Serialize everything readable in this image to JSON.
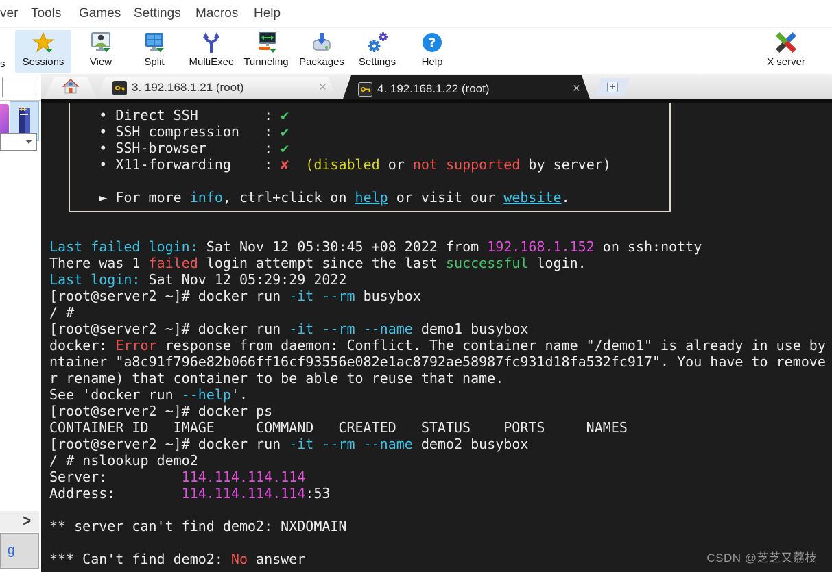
{
  "menu": {
    "items": [
      "ver",
      "Tools",
      "Games",
      "Settings",
      "Macros",
      "Help"
    ]
  },
  "toolbar": {
    "partial_label": "s",
    "buttons": [
      {
        "label": "Sessions",
        "icon": "sessions-star-icon",
        "highlighted": true
      },
      {
        "label": "View",
        "icon": "view-monitor-user-icon"
      },
      {
        "label": "Split",
        "icon": "split-monitor-icon"
      },
      {
        "label": "MultiExec",
        "icon": "multiexec-fork-icon"
      },
      {
        "label": "Tunneling",
        "icon": "tunneling-monitor-icon"
      },
      {
        "label": "Packages",
        "icon": "packages-drive-icon"
      },
      {
        "label": "Settings",
        "icon": "settings-gears-icon"
      },
      {
        "label": "Help",
        "icon": "help-question-icon"
      }
    ],
    "xserver_label": "X server",
    "xserver_icon": "x-server-logo-icon"
  },
  "tabs": {
    "home_icon": "home-icon",
    "tab3": {
      "label": "3. 192.168.1.21 (root)",
      "close": "×",
      "icon": "key-icon"
    },
    "tab4": {
      "label": "4. 192.168.1.22 (root)",
      "close": "×",
      "icon": "key-icon",
      "active": true
    },
    "add_label": "+"
  },
  "sidebar": {
    "search_value": "",
    "expand_arrow": ">",
    "button_label": "g"
  },
  "terminal": {
    "bg": "#1d1d1d",
    "colors": {
      "white": "#ececec",
      "cyan": "#3fc1e4",
      "green": "#44c768",
      "red": "#ee5450",
      "yellow": "#d7d72a",
      "magenta": "#e052dc"
    },
    "lines": [
      {
        "segs": [
          {
            "t": "      • Direct SSH        : ",
            "c": "white"
          },
          {
            "t": "✔",
            "c": "green"
          }
        ]
      },
      {
        "segs": [
          {
            "t": "      • SSH compression   : ",
            "c": "white"
          },
          {
            "t": "✔",
            "c": "green"
          }
        ]
      },
      {
        "segs": [
          {
            "t": "      • SSH-browser       : ",
            "c": "white"
          },
          {
            "t": "✔",
            "c": "green"
          }
        ]
      },
      {
        "segs": [
          {
            "t": "      • X11-forwarding    : ",
            "c": "white"
          },
          {
            "t": "✘",
            "c": "red"
          },
          {
            "t": "  ",
            "c": "white"
          },
          {
            "t": "(disabled",
            "c": "yellow"
          },
          {
            "t": " or ",
            "c": "white"
          },
          {
            "t": "not supported",
            "c": "red"
          },
          {
            "t": " by server)",
            "c": "white"
          }
        ]
      },
      {
        "segs": []
      },
      {
        "segs": [
          {
            "t": "      ► For more ",
            "c": "white"
          },
          {
            "t": "info",
            "c": "cyan"
          },
          {
            "t": ", ctrl+click on ",
            "c": "white"
          },
          {
            "t": "help",
            "c": "cyan",
            "u": true
          },
          {
            "t": " or visit our ",
            "c": "white"
          },
          {
            "t": "website",
            "c": "cyan",
            "u": true
          },
          {
            "t": ".",
            "c": "white"
          }
        ]
      },
      {
        "segs": []
      },
      {
        "segs": []
      },
      {
        "segs": [
          {
            "t": "Last failed login:",
            "c": "cyan"
          },
          {
            "t": " Sat Nov 12 05:30:45 +08 2022 from ",
            "c": "white"
          },
          {
            "t": "192.168.1.152",
            "c": "magenta"
          },
          {
            "t": " on ssh:notty",
            "c": "white"
          }
        ]
      },
      {
        "segs": [
          {
            "t": "There was 1 ",
            "c": "white"
          },
          {
            "t": "failed",
            "c": "red"
          },
          {
            "t": " login attempt since the last ",
            "c": "white"
          },
          {
            "t": "successful",
            "c": "green"
          },
          {
            "t": " login.",
            "c": "white"
          }
        ]
      },
      {
        "segs": [
          {
            "t": "Last login:",
            "c": "cyan"
          },
          {
            "t": " Sat Nov 12 05:29:29 2022",
            "c": "white"
          }
        ]
      },
      {
        "segs": [
          {
            "t": "[root@server2 ~]# docker run ",
            "c": "white"
          },
          {
            "t": "-it",
            "c": "cyan"
          },
          {
            "t": " ",
            "c": "white"
          },
          {
            "t": "--rm",
            "c": "cyan"
          },
          {
            "t": " busybox",
            "c": "white"
          }
        ]
      },
      {
        "segs": [
          {
            "t": "/ #",
            "c": "white"
          }
        ]
      },
      {
        "segs": [
          {
            "t": "[root@server2 ~]# docker run ",
            "c": "white"
          },
          {
            "t": "-it",
            "c": "cyan"
          },
          {
            "t": " ",
            "c": "white"
          },
          {
            "t": "--rm",
            "c": "cyan"
          },
          {
            "t": " ",
            "c": "white"
          },
          {
            "t": "--name",
            "c": "cyan"
          },
          {
            "t": " demo1 busybox",
            "c": "white"
          }
        ]
      },
      {
        "segs": [
          {
            "t": "docker: ",
            "c": "white"
          },
          {
            "t": "Error",
            "c": "red"
          },
          {
            "t": " response from daemon: Conflict. The container name \"/demo1\" is already in use by",
            "c": "white"
          }
        ]
      },
      {
        "segs": [
          {
            "t": "ntainer \"a8c91f796e82b066ff16cf93556e082e1ac8792ae58987fc931d18fa532fc917\". You have to remove",
            "c": "white"
          }
        ]
      },
      {
        "segs": [
          {
            "t": "r rename) that container to be able to reuse that name.",
            "c": "white"
          }
        ]
      },
      {
        "segs": [
          {
            "t": "See 'docker run ",
            "c": "white"
          },
          {
            "t": "--help",
            "c": "cyan"
          },
          {
            "t": "'.",
            "c": "white"
          }
        ]
      },
      {
        "segs": [
          {
            "t": "[root@server2 ~]# docker ps",
            "c": "white"
          }
        ]
      },
      {
        "segs": [
          {
            "t": "CONTAINER ID   IMAGE     COMMAND   CREATED   STATUS    PORTS     NAMES",
            "c": "white"
          }
        ]
      },
      {
        "segs": [
          {
            "t": "[root@server2 ~]# docker run ",
            "c": "white"
          },
          {
            "t": "-it",
            "c": "cyan"
          },
          {
            "t": " ",
            "c": "white"
          },
          {
            "t": "--rm",
            "c": "cyan"
          },
          {
            "t": " ",
            "c": "white"
          },
          {
            "t": "--name",
            "c": "cyan"
          },
          {
            "t": " demo2 busybox",
            "c": "white"
          }
        ]
      },
      {
        "segs": [
          {
            "t": "/ # nslookup demo2",
            "c": "white"
          }
        ]
      },
      {
        "segs": [
          {
            "t": "Server:         ",
            "c": "white"
          },
          {
            "t": "114.114.114.114",
            "c": "magenta"
          }
        ]
      },
      {
        "segs": [
          {
            "t": "Address:        ",
            "c": "white"
          },
          {
            "t": "114.114.114.114",
            "c": "magenta"
          },
          {
            "t": ":53",
            "c": "white"
          }
        ]
      },
      {
        "segs": []
      },
      {
        "segs": [
          {
            "t": "** server can't find demo2: NXDOMAIN",
            "c": "white"
          }
        ]
      },
      {
        "segs": []
      },
      {
        "segs": [
          {
            "t": "*** Can't find demo2: ",
            "c": "white"
          },
          {
            "t": "No",
            "c": "red"
          },
          {
            "t": " answer",
            "c": "white"
          }
        ]
      }
    ]
  },
  "watermark": "CSDN @芝芝又荔枝"
}
